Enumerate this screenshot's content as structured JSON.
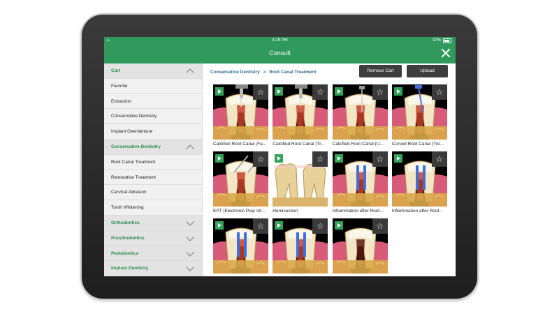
{
  "status_bar": {
    "time": "3:15 PM",
    "battery": "97%"
  },
  "title": "Consult",
  "sidebar": {
    "items": [
      {
        "label": "Cart",
        "type": "header",
        "chevron": "up"
      },
      {
        "label": "Favorite",
        "type": "item"
      },
      {
        "label": "Extraction",
        "type": "item"
      },
      {
        "label": "Conservative Dentistry",
        "type": "item"
      },
      {
        "label": "Implant Overdenture",
        "type": "item"
      },
      {
        "label": "Conservative Dentistry",
        "type": "header",
        "chevron": "up"
      },
      {
        "label": "Root Canal Treatment",
        "type": "item"
      },
      {
        "label": "Restorative Treatment",
        "type": "item"
      },
      {
        "label": "Cervical Abrasion",
        "type": "item"
      },
      {
        "label": "Tooth Whitening",
        "type": "item"
      },
      {
        "label": "Orthodontics",
        "type": "header",
        "chevron": "down"
      },
      {
        "label": "Prosthodontics",
        "type": "header",
        "chevron": "down"
      },
      {
        "label": "Pedodontics",
        "type": "header",
        "chevron": "down"
      },
      {
        "label": "Implant Dentistry",
        "type": "header",
        "chevron": "down"
      }
    ]
  },
  "breadcrumb": {
    "parent": "Conservative Dentistry",
    "separator": ">",
    "current": "Root Canal Treatment"
  },
  "toolbar": {
    "remove_label": "Remove Cart",
    "upload_label": "Upload"
  },
  "videos": [
    {
      "caption": "Calcified Root Canal (Fa...",
      "tool": "drill"
    },
    {
      "caption": "Calcified Root Canal (Tr...",
      "tool": "drill"
    },
    {
      "caption": "Calcified Root Canal (U...",
      "tool": "file"
    },
    {
      "caption": "Curved Root Canal (Tre...",
      "tool": "file-blue"
    },
    {
      "caption": "EPT (Electronic Pulp Vit...",
      "tool": "probe"
    },
    {
      "caption": "Hemisection",
      "tool": "molar"
    },
    {
      "caption": "Inflammation after Root...",
      "tool": "blue"
    },
    {
      "caption": "Inflammation after Root...",
      "tool": "blue"
    },
    {
      "caption": "",
      "tool": "blue"
    },
    {
      "caption": "",
      "tool": "blue"
    },
    {
      "caption": "",
      "tool": "dark"
    }
  ],
  "colors": {
    "accent": "#2f9a5c",
    "button": "#3e3e3e",
    "link": "#2d6a8f"
  }
}
